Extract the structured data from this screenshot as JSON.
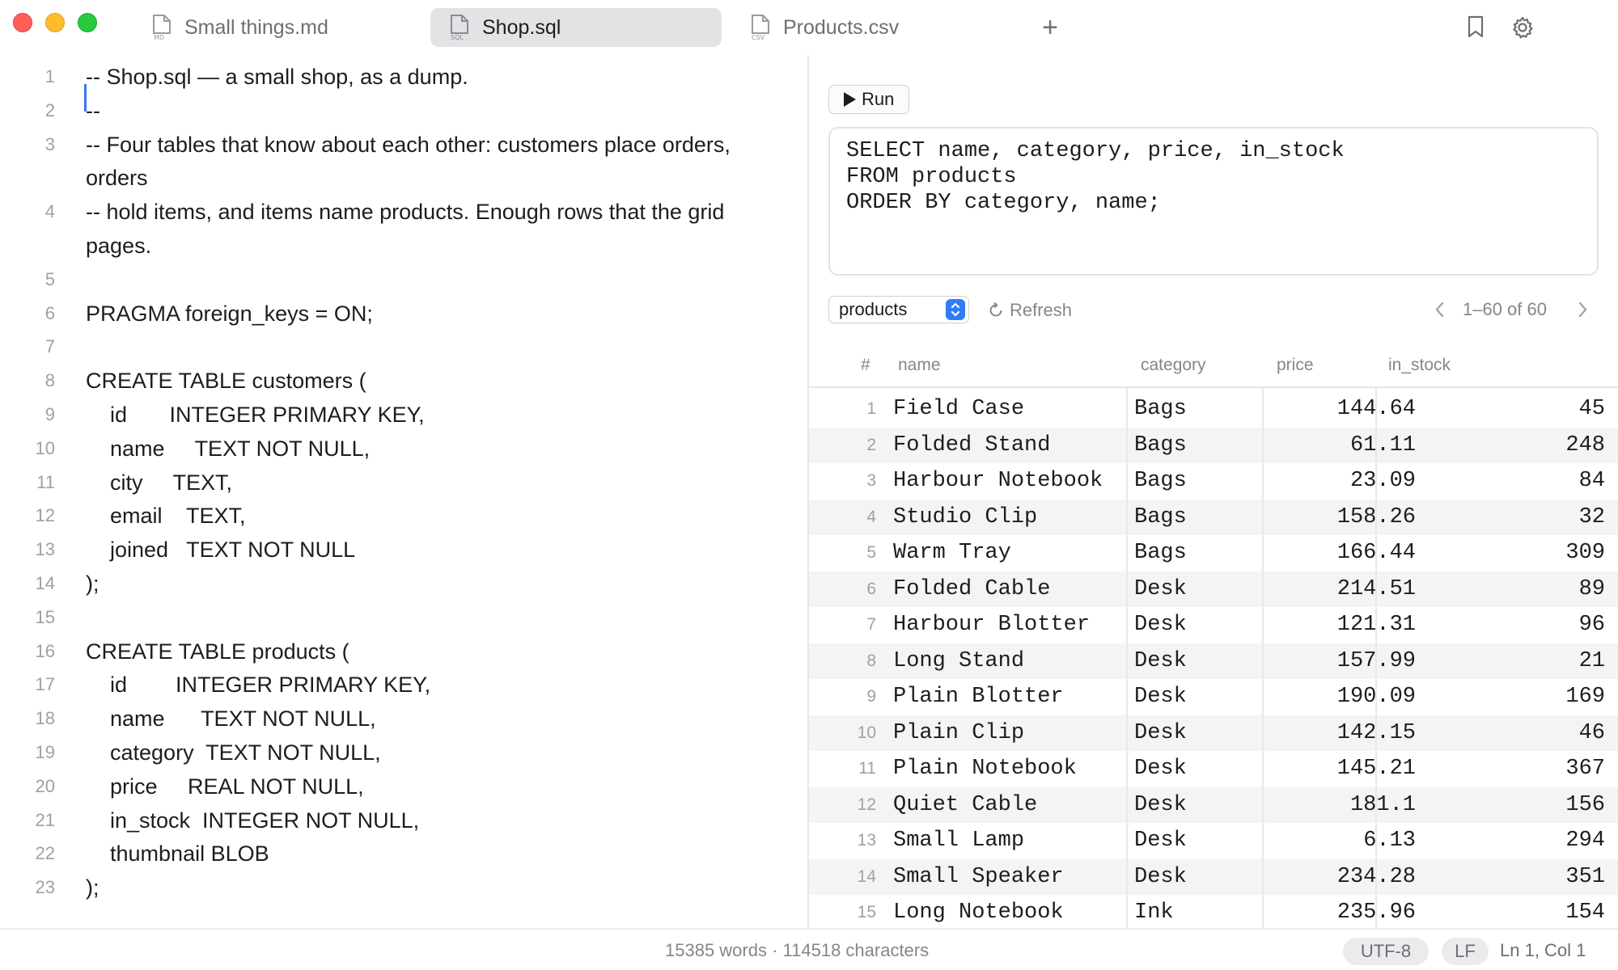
{
  "tabs": [
    {
      "label": "Small things.md",
      "icon_tag": "MD",
      "active": false
    },
    {
      "label": "Shop.sql",
      "icon_tag": "SQL",
      "active": true
    },
    {
      "label": "Products.csv",
      "icon_tag": "CSV",
      "active": false
    }
  ],
  "toolbar": {
    "new_tab": "+"
  },
  "editor": {
    "lines": [
      {
        "n": "1",
        "text": "-- Shop.sql — a small shop, as a dump."
      },
      {
        "n": "2",
        "text": "--"
      },
      {
        "n": "3",
        "text": "-- Four tables that know about each other: customers place orders,",
        "wrap": "orders"
      },
      {
        "n": "4",
        "text": "-- hold items, and items name products. Enough rows that the grid",
        "wrap": "pages."
      },
      {
        "n": "5",
        "text": ""
      },
      {
        "n": "6",
        "text": "PRAGMA foreign_keys = ON;"
      },
      {
        "n": "7",
        "text": ""
      },
      {
        "n": "8",
        "text": "CREATE TABLE customers ("
      },
      {
        "n": "9",
        "text": "    id       INTEGER PRIMARY KEY,"
      },
      {
        "n": "10",
        "text": "    name     TEXT NOT NULL,"
      },
      {
        "n": "11",
        "text": "    city     TEXT,"
      },
      {
        "n": "12",
        "text": "    email    TEXT,"
      },
      {
        "n": "13",
        "text": "    joined   TEXT NOT NULL"
      },
      {
        "n": "14",
        "text": ");"
      },
      {
        "n": "15",
        "text": ""
      },
      {
        "n": "16",
        "text": "CREATE TABLE products ("
      },
      {
        "n": "17",
        "text": "    id        INTEGER PRIMARY KEY,"
      },
      {
        "n": "18",
        "text": "    name      TEXT NOT NULL,"
      },
      {
        "n": "19",
        "text": "    category  TEXT NOT NULL,"
      },
      {
        "n": "20",
        "text": "    price     REAL NOT NULL,"
      },
      {
        "n": "21",
        "text": "    in_stock  INTEGER NOT NULL,"
      },
      {
        "n": "22",
        "text": "    thumbnail BLOB"
      },
      {
        "n": "23",
        "text": ");"
      }
    ]
  },
  "query": {
    "run_label": "Run",
    "sql_lines": [
      "SELECT name, category, price, in_stock",
      "FROM products",
      "ORDER BY category, name;"
    ]
  },
  "results": {
    "table_select": "products",
    "refresh_label": "Refresh",
    "pager": "1–60 of 60",
    "columns": [
      "#",
      "name",
      "category",
      "price",
      "in_stock"
    ],
    "rows": [
      [
        "1",
        "Field Case",
        "Bags",
        "144.64",
        "45"
      ],
      [
        "2",
        "Folded Stand",
        "Bags",
        "61.11",
        "248"
      ],
      [
        "3",
        "Harbour Notebook",
        "Bags",
        "23.09",
        "84"
      ],
      [
        "4",
        "Studio Clip",
        "Bags",
        "158.26",
        "32"
      ],
      [
        "5",
        "Warm Tray",
        "Bags",
        "166.44",
        "309"
      ],
      [
        "6",
        "Folded Cable",
        "Desk",
        "214.51",
        "89"
      ],
      [
        "7",
        "Harbour Blotter",
        "Desk",
        "121.31",
        "96"
      ],
      [
        "8",
        "Long Stand",
        "Desk",
        "157.99",
        "21"
      ],
      [
        "9",
        "Plain Blotter",
        "Desk",
        "190.09",
        "169"
      ],
      [
        "10",
        "Plain Clip",
        "Desk",
        "142.15",
        "46"
      ],
      [
        "11",
        "Plain Notebook",
        "Desk",
        "145.21",
        "367"
      ],
      [
        "12",
        "Quiet Cable",
        "Desk",
        "181.1",
        "156"
      ],
      [
        "13",
        "Small Lamp",
        "Desk",
        "6.13",
        "294"
      ],
      [
        "14",
        "Small Speaker",
        "Desk",
        "234.28",
        "351"
      ],
      [
        "15",
        "Long Notebook",
        "Ink",
        "235.96",
        "154"
      ]
    ]
  },
  "status": {
    "stats": "15385 words · 114518 characters",
    "encoding": "UTF-8",
    "line_ending": "LF",
    "cursor": "Ln 1, Col 1"
  },
  "colors": {
    "accent": "#2f7cf6",
    "close": "#ff5f57",
    "minimize": "#febc2e",
    "zoom": "#28c840"
  }
}
